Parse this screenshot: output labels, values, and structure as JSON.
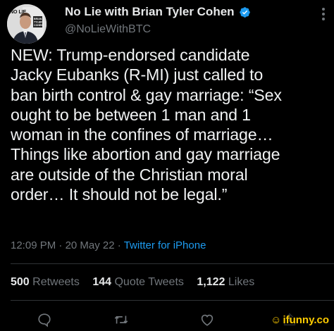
{
  "profile": {
    "display_name": "No Lie with Brian Tyler Cohen",
    "handle": "@NoLieWithBTC",
    "avatar_logo_lines": [
      "NO LIE",
      "BRIAN",
      "TYLER",
      "COHEN"
    ]
  },
  "tweet": {
    "text": "NEW: Trump-endorsed candidate\nJacky Eubanks (R-MI) just called to\nban birth control & gay marriage: “Sex\nought to be between 1 man and 1\nwoman in the confines of marriage…\nThings like abortion and gay marriage\nare outside of the Christian moral\norder… It should not be legal.”",
    "time": "12:09 PM",
    "date": "20 May 22",
    "separator": "·",
    "source": "Twitter for iPhone"
  },
  "stats": {
    "retweets_count": "500",
    "retweets_label": "Retweets",
    "quotes_count": "144",
    "quotes_label": "Quote Tweets",
    "likes_count": "1,122",
    "likes_label": "Likes"
  },
  "watermark": {
    "text": "ifunny.co"
  },
  "colors": {
    "background": "#000000",
    "primary_text": "#e7e9ea",
    "secondary_text": "#71767b",
    "link": "#1d9bf0",
    "divider": "#2f3336",
    "verified_badge": "#1d9bf0",
    "watermark": "#ffcc00"
  },
  "icons": {
    "verified": "verified-badge-icon",
    "more": "more-vertical-icon",
    "reply": "reply-icon",
    "retweet": "retweet-icon",
    "like": "heart-icon",
    "share": "share-icon"
  }
}
